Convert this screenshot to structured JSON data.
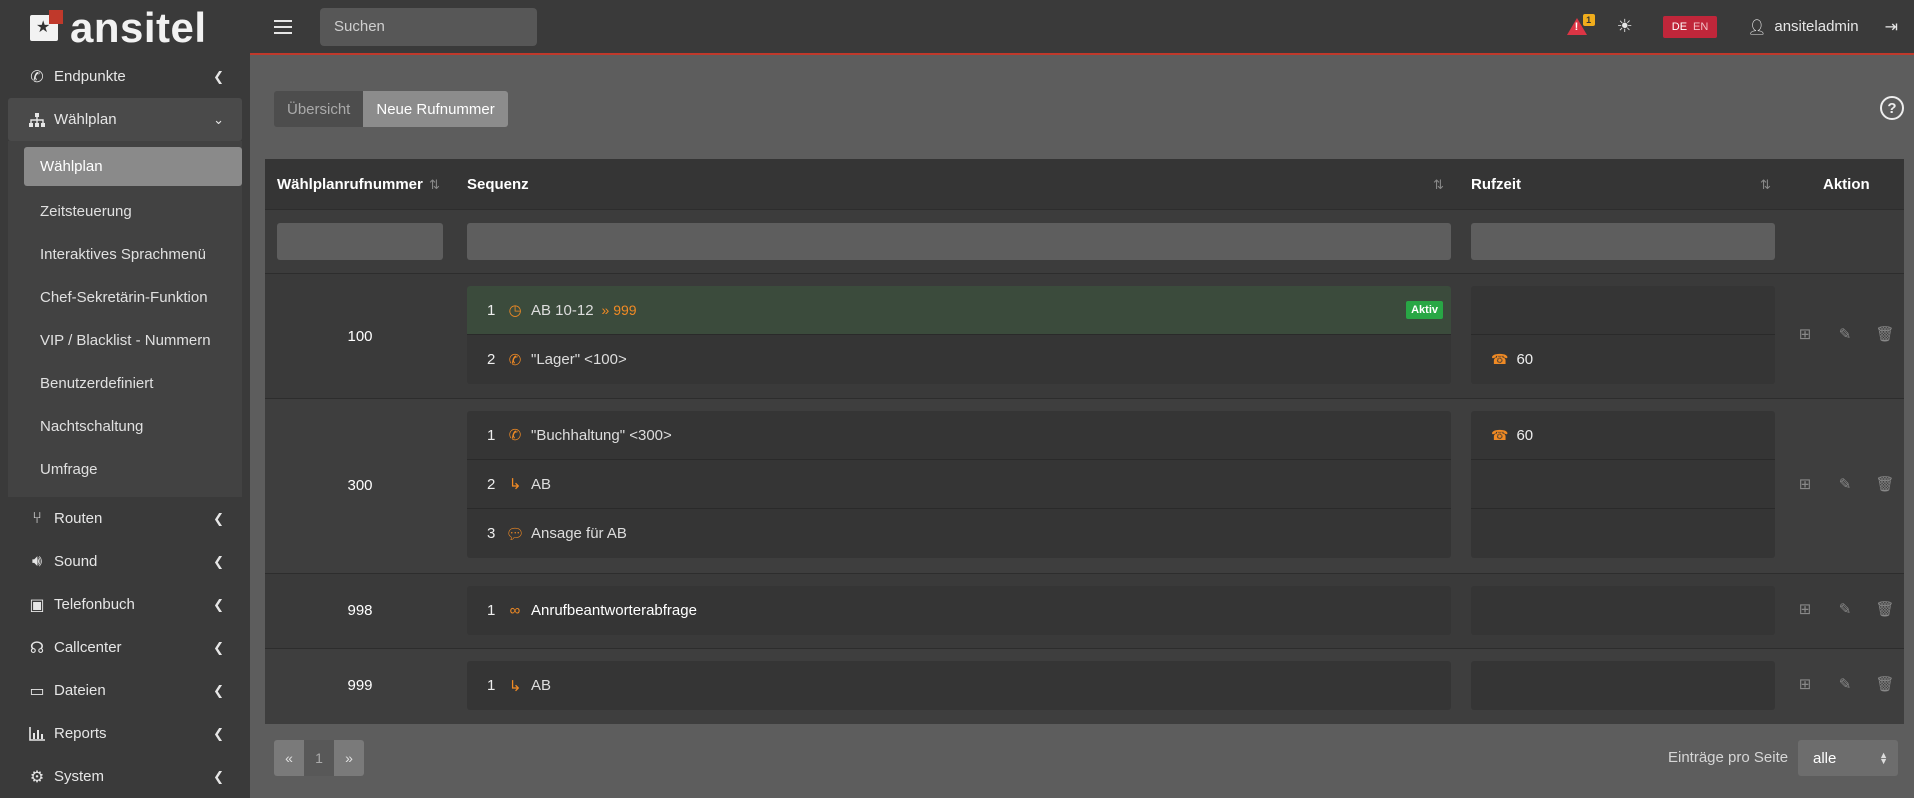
{
  "app": {
    "name": "ansitel"
  },
  "search": {
    "placeholder": "Suchen"
  },
  "topbar": {
    "alert_count": "1",
    "lang": [
      "DE",
      "EN"
    ],
    "user": "ansiteladmin"
  },
  "sidebar": {
    "items": [
      {
        "label": "Endpunkte"
      },
      {
        "label": "Wählplan"
      },
      {
        "label": "Routen"
      },
      {
        "label": "Sound"
      },
      {
        "label": "Telefonbuch"
      },
      {
        "label": "Callcenter"
      },
      {
        "label": "Dateien"
      },
      {
        "label": "Reports"
      },
      {
        "label": "System"
      }
    ],
    "submenu": [
      "Wählplan",
      "Zeitsteuerung",
      "Interaktives Sprachmenü",
      "Chef-Sekretärin-Funktion",
      "VIP / Blacklist - Nummern",
      "Benutzerdefiniert",
      "Nachtschaltung",
      "Umfrage"
    ]
  },
  "tabs": [
    "Übersicht",
    "Neue Rufnummer"
  ],
  "table": {
    "headers": [
      "Wählplanrufnummer",
      "Sequenz",
      "Rufzeit",
      "Aktion"
    ],
    "rows": [
      {
        "number": "100",
        "sequence": [
          {
            "n": "1",
            "icon": "clock-icon",
            "label": "AB 10-12",
            "target": "» 999",
            "badge": "Aktiv"
          },
          {
            "n": "2",
            "icon": "phone-icon",
            "label": "\"Lager\" <100>"
          }
        ],
        "rufzeit": [
          "",
          "60"
        ]
      },
      {
        "number": "300",
        "sequence": [
          {
            "n": "1",
            "icon": "phone-icon",
            "label": "\"Buchhaltung\" <300>"
          },
          {
            "n": "2",
            "icon": "forward-icon",
            "label": "AB"
          },
          {
            "n": "3",
            "icon": "speech-icon",
            "label": "Ansage für AB"
          }
        ],
        "rufzeit": [
          "60",
          "",
          ""
        ]
      },
      {
        "number": "998",
        "sequence": [
          {
            "n": "1",
            "icon": "voicemail-icon",
            "label": "Anrufbeantworterabfrage"
          }
        ],
        "rufzeit": [
          ""
        ]
      },
      {
        "number": "999",
        "sequence": [
          {
            "n": "1",
            "icon": "forward-icon",
            "label": "AB"
          }
        ],
        "rufzeit": [
          ""
        ]
      }
    ]
  },
  "pagination": {
    "prev": "«",
    "page": "1",
    "next": "»"
  },
  "per_page": {
    "label": "Einträge pro Seite",
    "value": "alle"
  }
}
